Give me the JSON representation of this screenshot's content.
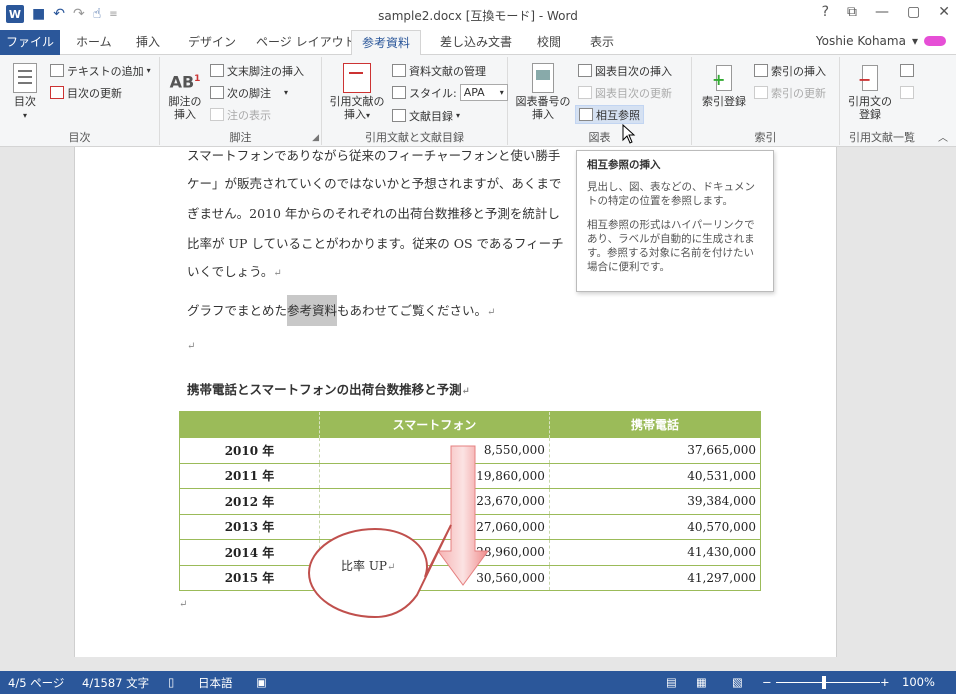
{
  "titlebar": {
    "title": "sample2.docx [互換モード] - Word",
    "help": "?",
    "restore": "⧉",
    "minimize": "—",
    "maximize": "▢",
    "close": "✕"
  },
  "tabs": [
    {
      "label": "ファイル"
    },
    {
      "label": "ホーム"
    },
    {
      "label": "挿入"
    },
    {
      "label": "デザイン"
    },
    {
      "label": "ページ レイアウト"
    },
    {
      "label": "参考資料"
    },
    {
      "label": "差し込み文書"
    },
    {
      "label": "校閲"
    },
    {
      "label": "表示"
    }
  ],
  "user": {
    "name": "Yoshie Kohama",
    "dropdown": "▾"
  },
  "ribbon": {
    "toc": {
      "label": "目次",
      "big": "目次",
      "add_text": "テキストの追加",
      "update": "目次の更新"
    },
    "footnote": {
      "label": "脚注",
      "big": "脚注の\n挿入",
      "endnote": "文末脚注の挿入",
      "next": "次の脚注",
      "show": "注の表示",
      "icon_text": "AB",
      "icon_sup": "1"
    },
    "citations": {
      "label": "引用文献と文献目録",
      "big": "引用文献の\n挿入",
      "manage": "資料文献の管理",
      "style_label": "スタイル:",
      "style_value": "APA",
      "bibliography": "文献目録"
    },
    "captions": {
      "label": "図表",
      "big": "図表番号の\n挿入",
      "insert_tof": "図表目次の挿入",
      "update_tof": "図表目次の更新",
      "cross_ref": "相互参照"
    },
    "index": {
      "label": "索引",
      "big": "索引登録",
      "insert": "索引の挿入",
      "update": "索引の更新"
    },
    "authorities": {
      "label": "引用文献一覧",
      "big": "引用文の\n登録"
    }
  },
  "document": {
    "lines": [
      "スマートフォンでありながら従来のフィーチャーフォンと使い勝手",
      "ケー」が販売されていくのではないかと予想されますが、あくまで",
      "ぎません。2010 年からのそれぞれの出荷台数推移と予測を統計し",
      "比率が UP していることがわかります。従来の OS であるフィーチ",
      "いくでしょう。"
    ],
    "graph_pre": "グラフでまとめた",
    "graph_hl": "参考資料",
    "graph_post": "もあわせてご覧ください。",
    "heading": "携帯電話とスマートフォンの出荷台数推移と予測",
    "mark": "↵"
  },
  "table": {
    "headers": [
      "",
      "スマートフォン",
      "携帯電話"
    ],
    "rows": [
      {
        "year": "2010 年",
        "smart": "8,550,000",
        "mobile": "37,665,000"
      },
      {
        "year": "2011 年",
        "smart": "19,860,000",
        "mobile": "40,531,000"
      },
      {
        "year": "2012 年",
        "smart": "23,670,000",
        "mobile": "39,384,000"
      },
      {
        "year": "2013 年",
        "smart": "27,060,000",
        "mobile": "40,570,000"
      },
      {
        "year": "2014 年",
        "smart": "28,960,000",
        "mobile": "41,430,000"
      },
      {
        "year": "2015 年",
        "smart": "30,560,000",
        "mobile": "41,297,000"
      }
    ]
  },
  "callout": {
    "text": "比率 UP"
  },
  "tooltip": {
    "title": "相互参照の挿入",
    "p1": "見出し、図、表などの、ドキュメントの特定の位置を参照します。",
    "p2": "相互参照の形式はハイパーリンクであり、ラベルが自動的に生成されます。参照する対象に名前を付けたい場合に便利です。"
  },
  "status": {
    "page": "4/5 ページ",
    "words": "4/1587 文字",
    "lang": "日本語",
    "zoom": "100%",
    "zoom_minus": "−",
    "zoom_plus": "+"
  },
  "colors": {
    "accent": "#2b579a",
    "table_header": "#9bbb59",
    "arrow": "#f28a8a",
    "callout_border": "#c0504d"
  }
}
